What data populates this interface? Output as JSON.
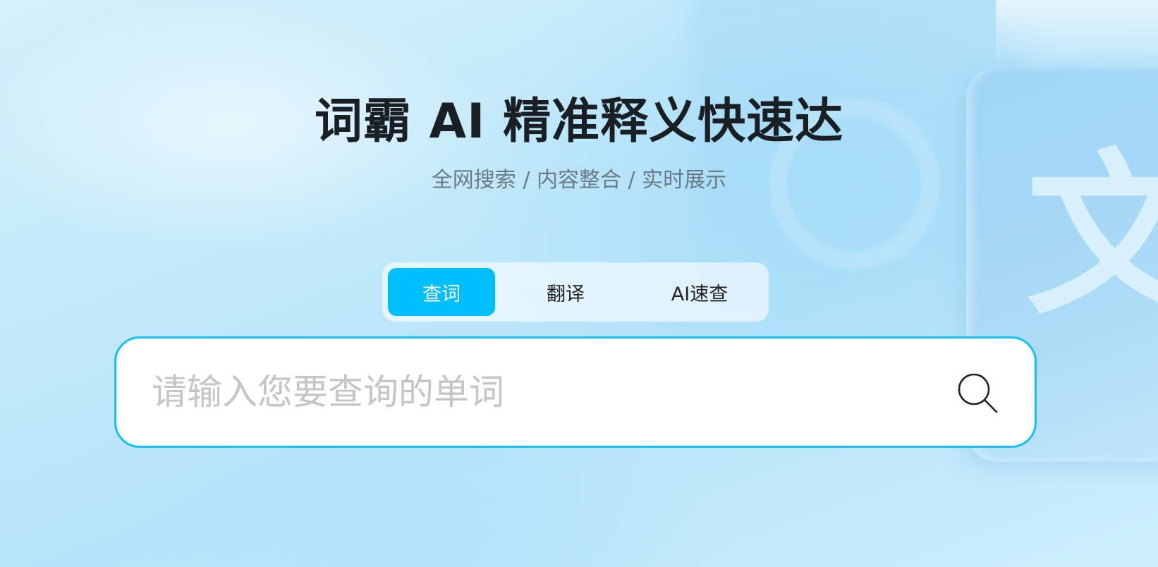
{
  "hero": {
    "title": "词霸 AI 精准释义快速达",
    "subtitle": "全网搜索 / 内容整合 / 实时展示"
  },
  "tabs": [
    {
      "label": "查词",
      "active": true
    },
    {
      "label": "翻译",
      "active": false
    },
    {
      "label": "AI速查",
      "active": false
    }
  ],
  "search": {
    "placeholder": "请输入您要查询的单词",
    "value": "",
    "icon": "search-icon"
  },
  "decoration": {
    "glyph": "文"
  },
  "colors": {
    "accent": "#00bfff",
    "border": "#12c1f6",
    "title": "#1a1f24",
    "subtitle": "#6b7b85"
  }
}
